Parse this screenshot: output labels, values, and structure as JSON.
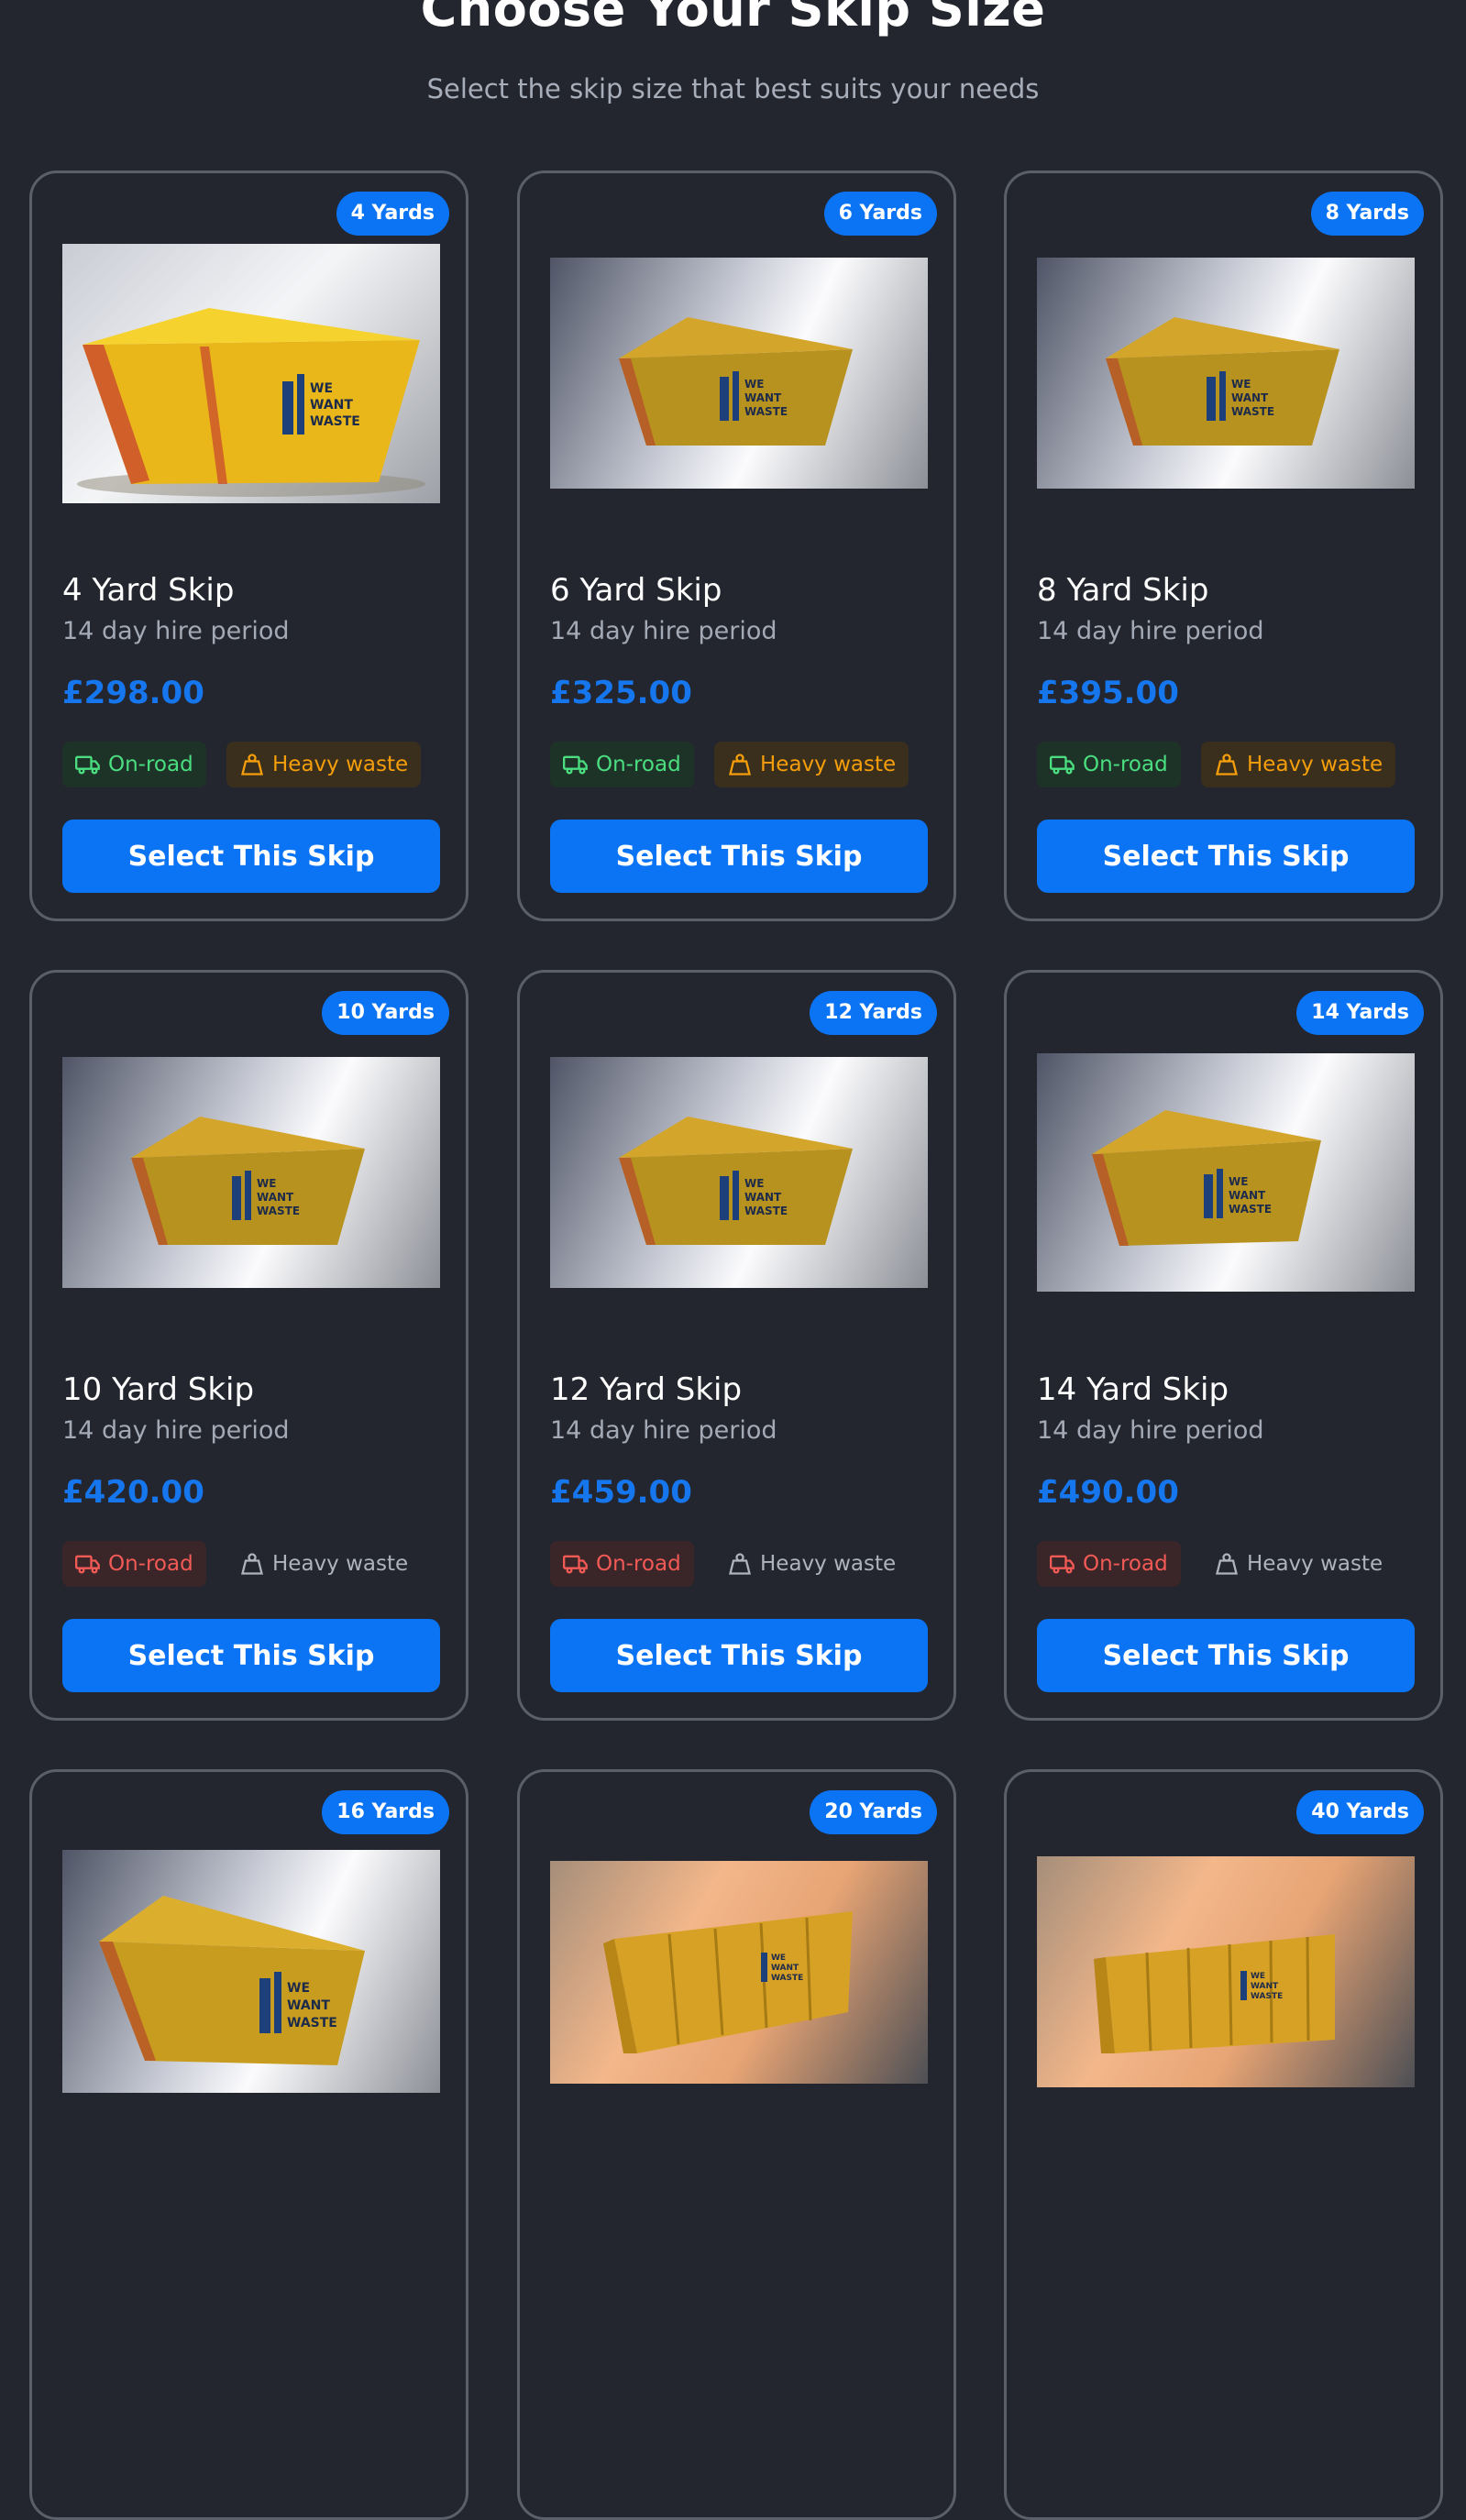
{
  "header": {
    "title": "Choose Your Skip Size",
    "subtitle": "Select the skip size that best suits your needs"
  },
  "skips": [
    {
      "badge": "4 Yards",
      "name": "4 Yard Skip",
      "hire": "14 day hire period",
      "price": "£298.00",
      "on_road": "On-road",
      "heavy": "Heavy waste",
      "select": "Select This Skip",
      "logo": [
        "WE",
        "WANT",
        "WASTE"
      ]
    },
    {
      "badge": "6 Yards",
      "name": "6 Yard Skip",
      "hire": "14 day hire period",
      "price": "£325.00",
      "on_road": "On-road",
      "heavy": "Heavy waste",
      "select": "Select This Skip",
      "logo": [
        "WE",
        "WANT",
        "WASTE"
      ]
    },
    {
      "badge": "8 Yards",
      "name": "8 Yard Skip",
      "hire": "14 day hire period",
      "price": "£395.00",
      "on_road": "On-road",
      "heavy": "Heavy waste",
      "select": "Select This Skip",
      "logo": [
        "WE",
        "WANT",
        "WASTE"
      ]
    },
    {
      "badge": "10 Yards",
      "name": "10 Yard Skip",
      "hire": "14 day hire period",
      "price": "£420.00",
      "on_road": "On-road",
      "heavy": "Heavy waste",
      "select": "Select This Skip",
      "logo": [
        "WE",
        "WANT",
        "WASTE"
      ]
    },
    {
      "badge": "12 Yards",
      "name": "12 Yard Skip",
      "hire": "14 day hire period",
      "price": "£459.00",
      "on_road": "On-road",
      "heavy": "Heavy waste",
      "select": "Select This Skip",
      "logo": [
        "WE",
        "WANT",
        "WASTE"
      ]
    },
    {
      "badge": "14 Yards",
      "name": "14 Yard Skip",
      "hire": "14 day hire period",
      "price": "£490.00",
      "on_road": "On-road",
      "heavy": "Heavy waste",
      "select": "Select This Skip",
      "logo": [
        "WE",
        "WANT",
        "WASTE"
      ]
    },
    {
      "badge": "16 Yards",
      "logo": [
        "WE",
        "WANT",
        "WASTE"
      ]
    },
    {
      "badge": "20 Yards",
      "logo": [
        "WE",
        "WANT",
        "WASTE"
      ]
    },
    {
      "badge": "40 Yards",
      "logo": [
        "WE",
        "WANT",
        "WASTE"
      ]
    }
  ],
  "colors": {
    "background": "#23262f",
    "accent": "#0b74f5",
    "price": "#1676ee",
    "on_road_allowed": "#4ade80",
    "on_road_not_allowed": "#f25a55",
    "heavy_allowed": "#f59e0b",
    "heavy_not_allowed": "#aeb3bd"
  }
}
